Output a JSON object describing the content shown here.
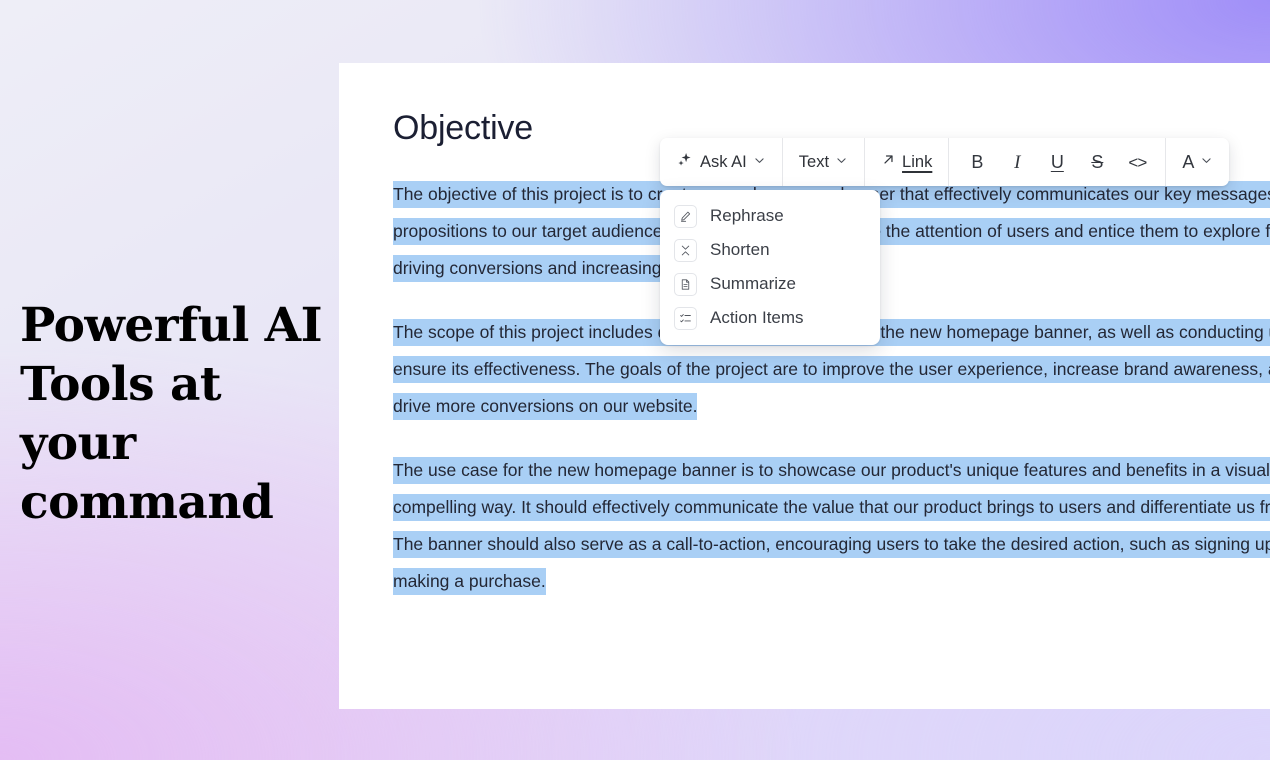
{
  "hero": {
    "title": "Powerful AI Tools at your command"
  },
  "document": {
    "heading": "Objective",
    "paragraphs": [
      "The objective of this project is to create a new homepage banner that effectively communicates our key messages and value propositions to our target audience. The banner should capture the attention of users and entice them to explore further, ultimately driving conversions and increasing engagement.",
      "The scope of this project includes designing and implementing the new homepage banner, as well as conducting user testing to ensure its effectiveness. The goals of the project are to improve the user experience, increase brand awareness, and ultimately drive more conversions on our website.",
      "The use case for the new homepage banner is to showcase our product's unique features and benefits in a visually appealing and compelling way. It should effectively communicate the value that our product brings to users and differentiate us from competitors. The banner should also serve as a call-to-action, encouraging users to take the desired action, such as signing up for a free trial or making a purchase."
    ]
  },
  "toolbar": {
    "ask_ai_label": "Ask AI",
    "text_label": "Text",
    "link_label": "Link",
    "bold_label": "B",
    "italic_label": "I",
    "underline_label": "U",
    "strikethrough_label": "S",
    "code_label": "<>",
    "font_label": "A",
    "caret": "∨"
  },
  "menu": {
    "items": [
      {
        "label": "Rephrase",
        "icon": "pencil-icon"
      },
      {
        "label": "Shorten",
        "icon": "shorten-arrows-icon"
      },
      {
        "label": "Summarize",
        "icon": "document-icon"
      },
      {
        "label": "Action Items",
        "icon": "checklist-icon"
      }
    ]
  },
  "colors": {
    "highlight": "#a9cff5",
    "card_background": "#ffffff",
    "text": "#232735",
    "gradient_top_left": "#eeeef7",
    "gradient_top_right": "#a08ff8",
    "gradient_bottom_left": "#e4bdf4",
    "gradient_bottom_right": "#dcd5fb"
  }
}
